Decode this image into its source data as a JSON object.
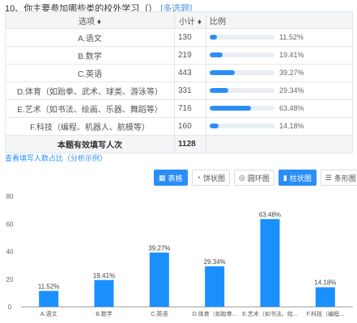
{
  "question": {
    "title": "10、你主要参加哪些类的校外学习（）",
    "tag": "[多选题]"
  },
  "table": {
    "headers": {
      "option": "选项 ♦",
      "count": "小计 ♦",
      "ratio": "比例"
    },
    "rows": [
      {
        "option": "A.语文",
        "count": "130",
        "percent": "11.52%",
        "value": 11.52
      },
      {
        "option": "B.数学",
        "count": "219",
        "percent": "19.41%",
        "value": 19.41
      },
      {
        "option": "C.英语",
        "count": "443",
        "percent": "39.27%",
        "value": 39.27
      },
      {
        "option": "D.体育（如跆拳、武术、球类、游泳等）",
        "count": "331",
        "percent": "29.34%",
        "value": 29.34
      },
      {
        "option": "E.艺术（如书法、绘画、乐器、舞蹈等）",
        "count": "716",
        "percent": "63.48%",
        "value": 63.48
      },
      {
        "option": "F.科技（编程、机器人、航模等）",
        "count": "160",
        "percent": "14.18%",
        "value": 14.18
      }
    ],
    "total": {
      "label": "本题有效填写人次",
      "count": "1128"
    }
  },
  "link": {
    "label": "查看填写人数占比（分析示例）"
  },
  "toolbar": {
    "buttons": [
      {
        "label": "表格",
        "icon": "table-icon",
        "active": true
      },
      {
        "label": "饼状图",
        "icon": "pie-chart-icon",
        "active": false
      },
      {
        "label": "圆环图",
        "icon": "donut-chart-icon",
        "active": false
      },
      {
        "label": "柱状图",
        "icon": "bar-chart-icon",
        "active": true
      },
      {
        "label": "条形图",
        "icon": "bar-horizontal-icon",
        "active": false
      }
    ]
  },
  "colors": {
    "accent": "#2b8ef7",
    "bar": "#1a90ff"
  },
  "chart_data": {
    "type": "bar",
    "categories": [
      "A.语文",
      "B.数学",
      "C.英语",
      "D.体育（如跆拳...",
      "E.艺术（如书法、绘...",
      "F.科技（编程..."
    ],
    "values": [
      11.52,
      19.41,
      39.27,
      29.34,
      63.48,
      14.18
    ],
    "labels": [
      "11.52%",
      "19.41%",
      "39.27%",
      "29.34%",
      "63.48%",
      "14.18%"
    ],
    "yticks": [
      "0",
      "20",
      "40",
      "60",
      "80"
    ],
    "ylim": [
      0,
      80
    ],
    "grid": false
  }
}
